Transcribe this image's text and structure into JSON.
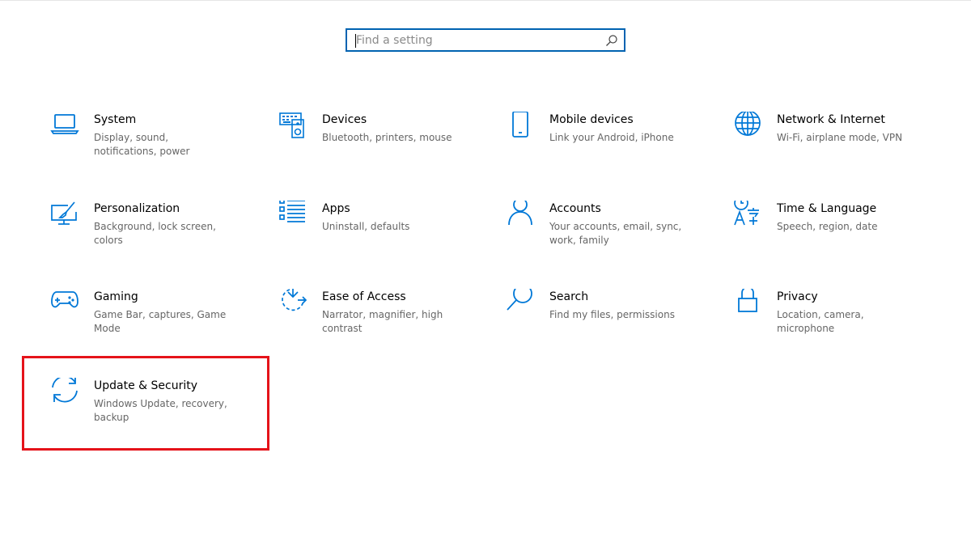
{
  "search": {
    "placeholder": "Find a setting"
  },
  "tiles": [
    {
      "title": "System",
      "desc": "Display, sound, notifications, power",
      "icon": "laptop-icon"
    },
    {
      "title": "Devices",
      "desc": "Bluetooth, printers, mouse",
      "icon": "keyboard-speaker-icon"
    },
    {
      "title": "Mobile devices",
      "desc": "Link your Android, iPhone",
      "icon": "phone-icon"
    },
    {
      "title": "Network & Internet",
      "desc": "Wi-Fi, airplane mode, VPN",
      "icon": "globe-icon"
    },
    {
      "title": "Personalization",
      "desc": "Background, lock screen, colors",
      "icon": "paintbrush-monitor-icon"
    },
    {
      "title": "Apps",
      "desc": "Uninstall, defaults",
      "icon": "apps-list-icon"
    },
    {
      "title": "Accounts",
      "desc": "Your accounts, email, sync, work, family",
      "icon": "person-icon"
    },
    {
      "title": "Time & Language",
      "desc": "Speech, region, date",
      "icon": "time-language-icon"
    },
    {
      "title": "Gaming",
      "desc": "Game Bar, captures, Game Mode",
      "icon": "gamepad-icon"
    },
    {
      "title": "Ease of Access",
      "desc": "Narrator, magnifier, high contrast",
      "icon": "ease-of-access-icon"
    },
    {
      "title": "Search",
      "desc": "Find my files, permissions",
      "icon": "search-magnifier-icon"
    },
    {
      "title": "Privacy",
      "desc": "Location, camera, microphone",
      "icon": "lock-icon"
    },
    {
      "title": "Update & Security",
      "desc": "Windows Update, recovery, backup",
      "icon": "sync-arrows-icon"
    }
  ],
  "colors": {
    "accent": "#0063b1",
    "icon": "#0078d7",
    "highlight": "#e5131a"
  }
}
